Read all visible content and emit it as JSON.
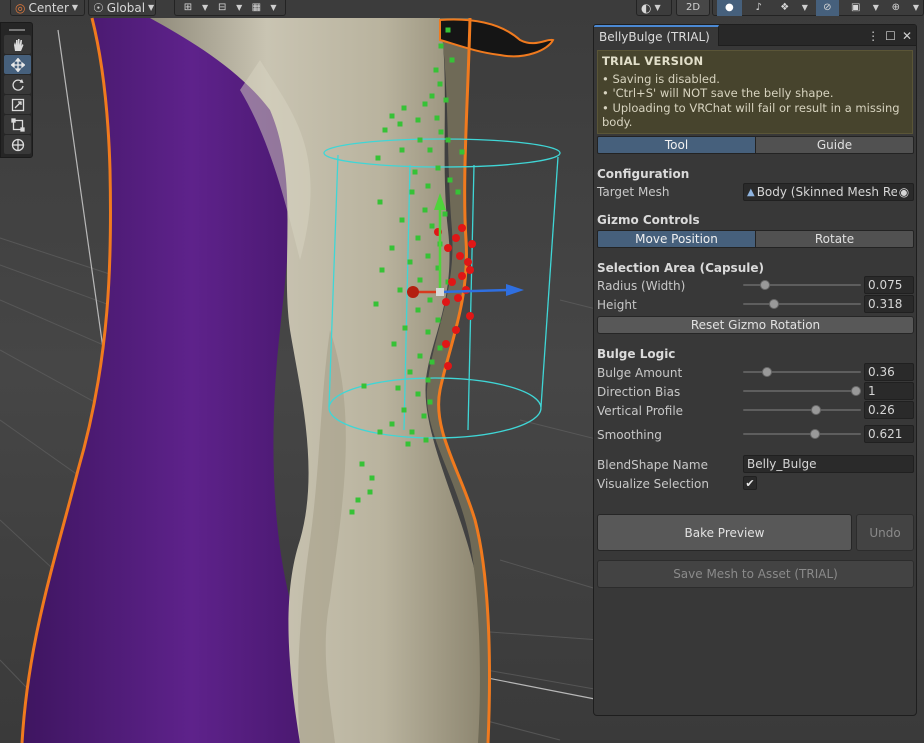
{
  "toolbar": {
    "pivot_mode": "Center",
    "pivot_rotation": "Global",
    "view_2d": "2D"
  },
  "palette": {
    "tools": [
      "hand-tool",
      "move-tool",
      "rotate-tool",
      "scale-tool",
      "rect-tool",
      "transform-tool"
    ],
    "active": "move-tool"
  },
  "panel": {
    "tab_title": "BellyBulge (TRIAL)",
    "warning": {
      "title": "TRIAL VERSION",
      "lines": [
        "• Saving is disabled.",
        "• 'Ctrl+S' will NOT save the belly shape.",
        "• Uploading to VRChat will fail or result in a missing body."
      ]
    },
    "mode_tabs": [
      "Tool",
      "Guide"
    ],
    "configuration": {
      "header": "Configuration",
      "target_mesh_label": "Target Mesh",
      "target_mesh_value": "Body (Skinned Mesh Rer"
    },
    "gizmo_controls": {
      "header": "Gizmo Controls",
      "buttons": [
        "Move Position",
        "Rotate"
      ]
    },
    "selection_area": {
      "header": "Selection Area (Capsule)",
      "radius_label": "Radius (Width)",
      "radius_value": "0.075",
      "radius_fill": 0.19,
      "height_label": "Height",
      "height_value": "0.318",
      "height_fill": 0.26,
      "reset_button": "Reset Gizmo Rotation"
    },
    "bulge_logic": {
      "header": "Bulge Logic",
      "amount_label": "Bulge Amount",
      "amount_value": "0.36",
      "amount_fill": 0.2,
      "bias_label": "Direction Bias",
      "bias_value": "1",
      "bias_fill": 0.96,
      "profile_label": "Vertical Profile",
      "profile_value": "0.26",
      "profile_fill": 0.62,
      "smoothing_label": "Smoothing",
      "smoothing_value": "0.621",
      "smoothing_fill": 0.61
    },
    "blendshape_label": "BlendShape Name",
    "blendshape_value": "Belly_Bulge",
    "visualize_label": "Visualize Selection",
    "visualize_checked": "✔",
    "bake_button": "Bake Preview",
    "undo_button": "Undo",
    "save_button": "Save Mesh to Asset (TRIAL)"
  },
  "colors": {
    "selection_outline": "#f07a1e",
    "capsule": "#3fd6d6",
    "purple_fur": "#5b1f86",
    "panel_bg": "#383838",
    "accent": "#46607c"
  }
}
